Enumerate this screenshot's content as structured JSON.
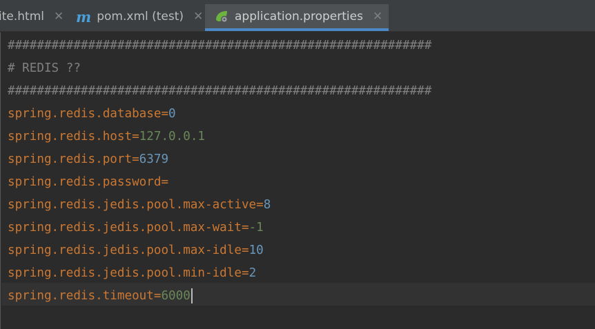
{
  "tabs": [
    {
      "label": "ite.html",
      "icon": "html-file-icon"
    },
    {
      "label": "pom.xml (test)",
      "icon": "maven-m-icon"
    },
    {
      "label": "application.properties",
      "icon": "spring-leaf-icon",
      "active": true
    }
  ],
  "colors": {
    "key": "#cc7832",
    "number": "#6897bb",
    "string": "#6a8759",
    "comment": "#808080",
    "background": "#2b2b2b",
    "active_tab_underline": "#4a88c7"
  },
  "editor": {
    "lines": [
      {
        "text": "##########################################################"
      },
      {
        "text": "# REDIS ??"
      },
      {
        "text": "##########################################################"
      },
      {
        "key": "spring.redis.database",
        "eq": "=",
        "value": "0"
      },
      {
        "key": "spring.redis.host",
        "eq": "=",
        "value": "127.0.0.1"
      },
      {
        "key": "spring.redis.port",
        "eq": "=",
        "value": "6379"
      },
      {
        "key": "spring.redis.password",
        "eq": "=",
        "value": ""
      },
      {
        "key": "spring.redis.jedis.pool.max-active",
        "eq": "=",
        "value": "8"
      },
      {
        "key": "spring.redis.jedis.pool.max-wait",
        "eq": "=",
        "value": "-1"
      },
      {
        "key": "spring.redis.jedis.pool.max-idle",
        "eq": "=",
        "value": "10"
      },
      {
        "key": "spring.redis.jedis.pool.min-idle",
        "eq": "=",
        "value": "2"
      },
      {
        "key": "spring.redis.timeout",
        "eq": "=",
        "value": "6000"
      }
    ]
  }
}
